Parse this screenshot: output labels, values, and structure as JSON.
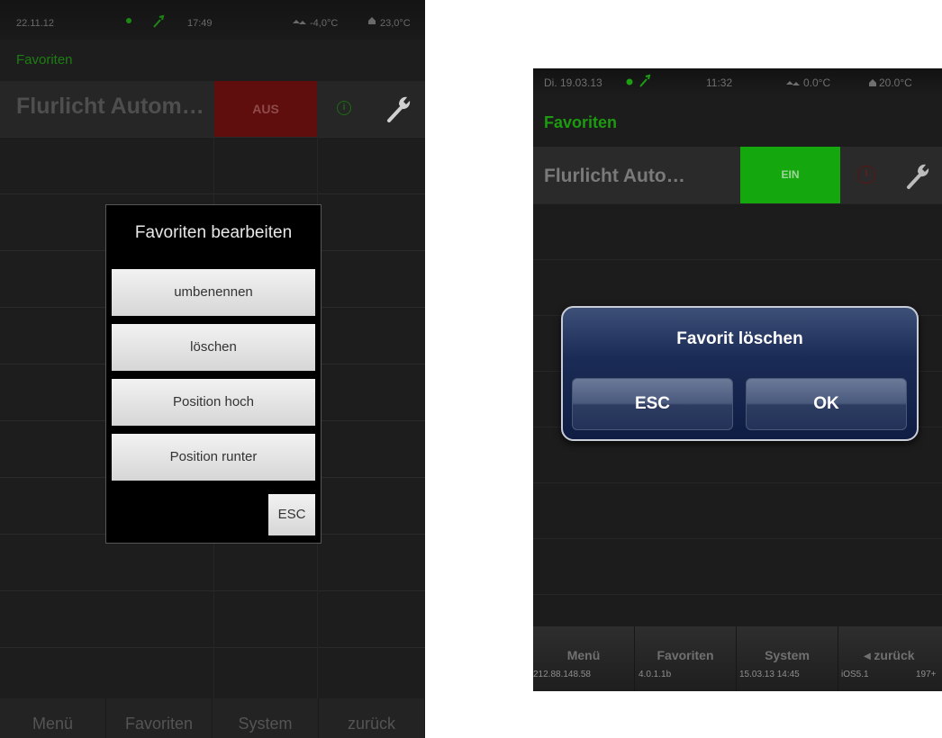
{
  "android": {
    "status": {
      "date": "22.11.12",
      "time": "17:49",
      "outdoor_temp": "-4,0°C",
      "indoor_temp": "23,0°C"
    },
    "section_title": "Favoriten",
    "favorite": {
      "label": "Flurlicht Autom…",
      "state": "AUS",
      "info_glyph": "i",
      "state_color": "#5f0d0d"
    },
    "dialog": {
      "title": "Favoriten bearbeiten",
      "buttons": [
        "umbenennen",
        "löschen",
        "Position hoch",
        "Position runter"
      ],
      "esc": "ESC"
    },
    "bottom_nav": [
      "Menü",
      "Favoriten",
      "System",
      "zurück"
    ]
  },
  "ios": {
    "status": {
      "date": "Di. 19.03.13",
      "time": "11:32",
      "outdoor_temp": "0.0°C",
      "indoor_temp": "20.0°C"
    },
    "section_title": "Favoriten",
    "favorite": {
      "label": "Flurlicht Auto…",
      "state": "EIN",
      "info_glyph": "i",
      "state_color": "#15a80e"
    },
    "dialog": {
      "title": "Favorit löschen",
      "esc": "ESC",
      "ok": "OK"
    },
    "bottom_nav": [
      {
        "label": "Menü",
        "sub": "212.88.148.58"
      },
      {
        "label": "Favoriten",
        "sub": "4.0.1.1b"
      },
      {
        "label": "System",
        "sub": "15.03.13 14:45"
      },
      {
        "label": "◂ zurück",
        "sub": "iOS5.1",
        "sub2": "197+"
      }
    ]
  },
  "icons": [
    "green-dot-icon",
    "wrench-icon",
    "cloud-house-icon",
    "house-icon",
    "info-icon"
  ]
}
